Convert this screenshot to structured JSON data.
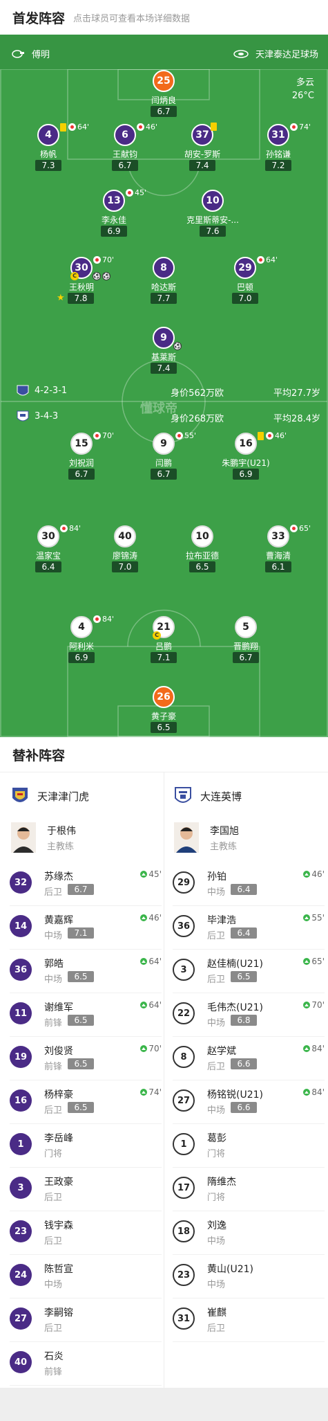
{
  "header": {
    "title": "首发阵容",
    "subtitle": "点击球员可查看本场详细数据"
  },
  "pitch": {
    "away_team_label": "傅明",
    "stadium": "天津泰达足球场",
    "weather": "多云",
    "temperature": "26°C",
    "watermark": "懂球帝"
  },
  "home_form": {
    "formation": "4-2-3-1",
    "value": "身价562万欧",
    "age": "平均27.7岁"
  },
  "away_form": {
    "formation": "3-4-3",
    "value": "身价268万欧",
    "age": "平均28.4岁"
  },
  "home_players": [
    {
      "num": "25",
      "name": "闫炳良",
      "rating": "6.7",
      "gk": true
    },
    {
      "num": "4",
      "name": "杨帆",
      "rating": "7.3",
      "yc": true,
      "sub": "64'"
    },
    {
      "num": "6",
      "name": "王献钧",
      "rating": "6.7",
      "sub": "46'"
    },
    {
      "num": "37",
      "name": "胡安-罗斯",
      "rating": "7.4",
      "yc": true
    },
    {
      "num": "31",
      "name": "孙铭谦",
      "rating": "7.2",
      "sub": "74'"
    },
    {
      "num": "13",
      "name": "李永佳",
      "rating": "6.9",
      "sub": "45'"
    },
    {
      "num": "10",
      "name": "克里斯蒂安-...",
      "rating": "7.6"
    },
    {
      "num": "30",
      "name": "王秋明",
      "rating": "7.8",
      "sub": "70'",
      "star": true
    },
    {
      "num": "8",
      "name": "哈达斯",
      "rating": "7.7"
    },
    {
      "num": "29",
      "name": "巴顿",
      "rating": "7.0",
      "sub": "64'"
    },
    {
      "num": "9",
      "name": "基莱斯",
      "rating": "7.4"
    }
  ],
  "away_players": [
    {
      "num": "15",
      "name": "刘祝润",
      "rating": "6.7",
      "sub": "70'"
    },
    {
      "num": "9",
      "name": "闫鹏",
      "rating": "6.7",
      "sub": "55'"
    },
    {
      "num": "16",
      "name": "朱鹏宇(U21)",
      "rating": "6.9",
      "yc": true,
      "sub": "46'"
    },
    {
      "num": "30",
      "name": "温家宝",
      "rating": "6.4",
      "sub": "84'"
    },
    {
      "num": "40",
      "name": "廖锦涛",
      "rating": "7.0"
    },
    {
      "num": "10",
      "name": "拉布亚德",
      "rating": "6.5"
    },
    {
      "num": "33",
      "name": "曹海清",
      "rating": "6.1",
      "sub": "65'"
    },
    {
      "num": "4",
      "name": "阿利米",
      "rating": "6.9",
      "sub": "84'"
    },
    {
      "num": "21",
      "name": "吕鹏",
      "rating": "7.1"
    },
    {
      "num": "5",
      "name": "晋鹏翔",
      "rating": "6.7"
    },
    {
      "num": "26",
      "name": "黄子豪",
      "rating": "6.5",
      "gk": true
    }
  ],
  "subs": {
    "title": "替补阵容",
    "home": {
      "team": "天津津门虎",
      "coach": {
        "name": "于根伟",
        "role": "主教练"
      },
      "players": [
        {
          "num": "32",
          "name": "苏缘杰",
          "pos": "后卫",
          "rating": "6.7",
          "min": "45'"
        },
        {
          "num": "14",
          "name": "黄嘉辉",
          "pos": "中场",
          "rating": "7.1",
          "min": "46'"
        },
        {
          "num": "36",
          "name": "郭皓",
          "pos": "中场",
          "rating": "6.5",
          "min": "64'"
        },
        {
          "num": "11",
          "name": "谢维军",
          "pos": "前锋",
          "rating": "6.5",
          "min": "64'"
        },
        {
          "num": "19",
          "name": "刘俊贤",
          "pos": "前锋",
          "rating": "6.5",
          "min": "70'"
        },
        {
          "num": "16",
          "name": "杨梓豪",
          "pos": "后卫",
          "rating": "6.5",
          "min": "74'"
        },
        {
          "num": "1",
          "name": "李岳峰",
          "pos": "门将"
        },
        {
          "num": "3",
          "name": "王政豪",
          "pos": "后卫"
        },
        {
          "num": "23",
          "name": "钱宇森",
          "pos": "后卫"
        },
        {
          "num": "24",
          "name": "陈哲宣",
          "pos": "中场"
        },
        {
          "num": "27",
          "name": "李嗣镕",
          "pos": "后卫"
        },
        {
          "num": "40",
          "name": "石炎",
          "pos": "前锋"
        }
      ]
    },
    "away": {
      "team": "大连英博",
      "coach": {
        "name": "李国旭",
        "role": "主教练"
      },
      "players": [
        {
          "num": "29",
          "name": "孙铂",
          "pos": "中场",
          "rating": "6.4",
          "min": "46'"
        },
        {
          "num": "36",
          "name": "毕津浩",
          "pos": "后卫",
          "rating": "6.4",
          "min": "55'"
        },
        {
          "num": "3",
          "name": "赵佳楠(U21)",
          "pos": "后卫",
          "rating": "6.5",
          "min": "65'"
        },
        {
          "num": "22",
          "name": "毛伟杰(U21)",
          "pos": "中场",
          "rating": "6.8",
          "min": "70'"
        },
        {
          "num": "8",
          "name": "赵学斌",
          "pos": "后卫",
          "rating": "6.6",
          "min": "84'"
        },
        {
          "num": "27",
          "name": "杨铭锐(U21)",
          "pos": "中场",
          "rating": "6.6",
          "min": "84'"
        },
        {
          "num": "1",
          "name": "葛彭",
          "pos": "门将"
        },
        {
          "num": "17",
          "name": "隋维杰",
          "pos": "门将"
        },
        {
          "num": "18",
          "name": "刘逸",
          "pos": "中场"
        },
        {
          "num": "23",
          "name": "黄山(U21)",
          "pos": "中场"
        },
        {
          "num": "31",
          "name": "崔麒",
          "pos": "后卫"
        }
      ]
    }
  },
  "colors": {
    "pitch": "#3da048",
    "home": "#4a2b86",
    "goalkeeper": "#f26a1b",
    "rating_bg": "#1b4e27"
  }
}
